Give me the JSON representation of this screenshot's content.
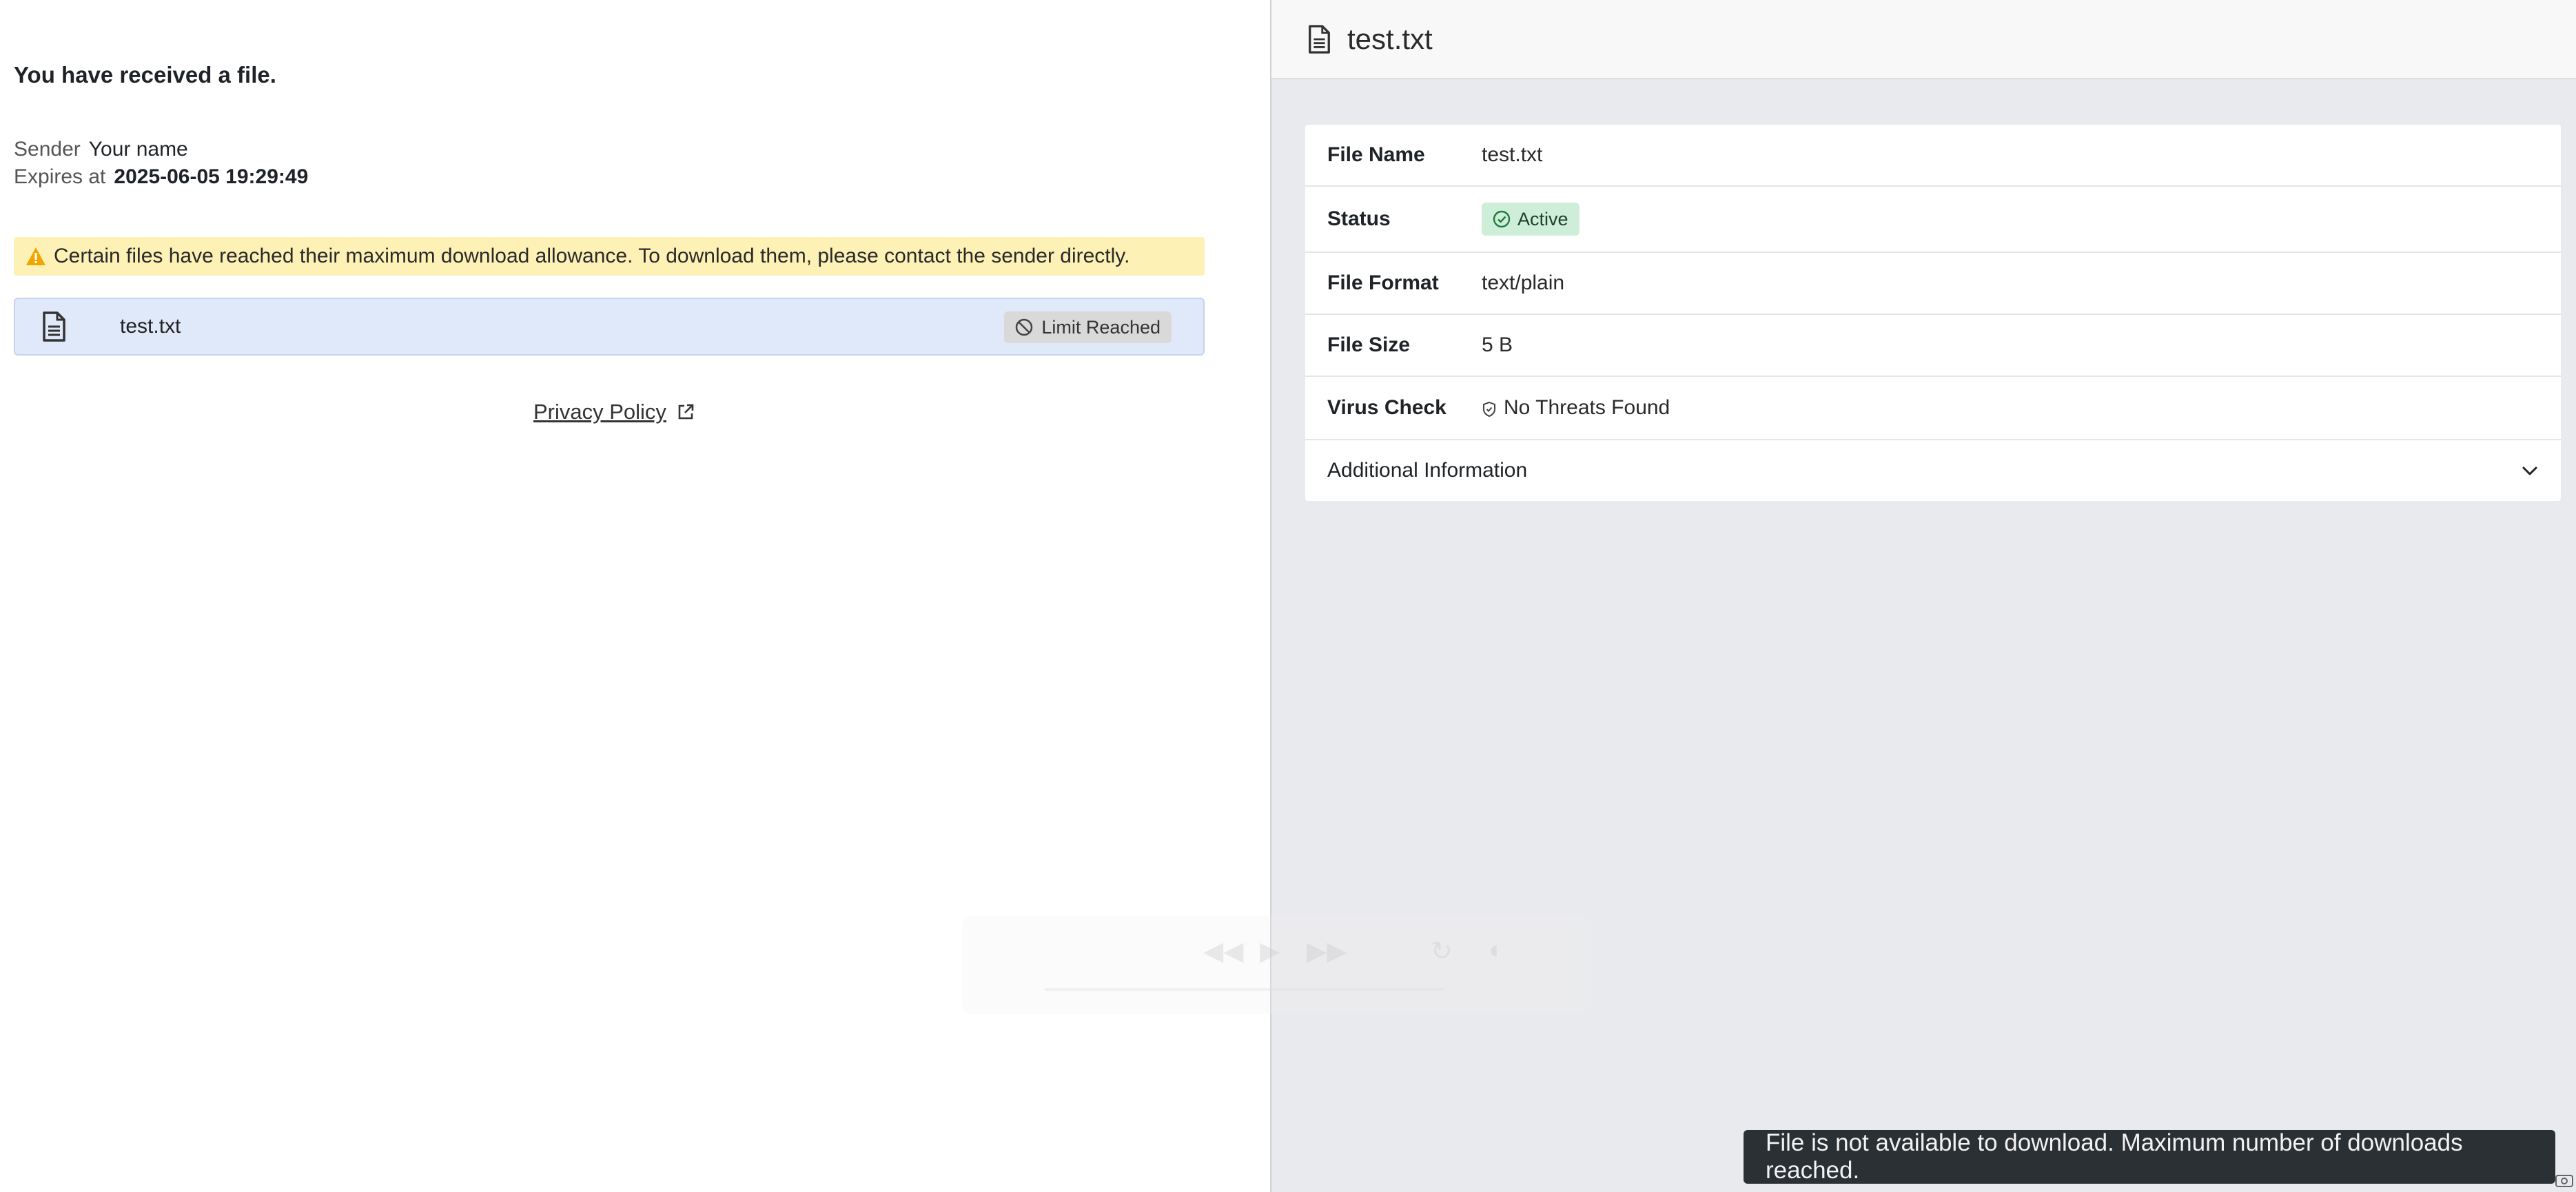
{
  "left": {
    "title": "You have received a file.",
    "sender_label": "Sender",
    "sender_value": "Your name",
    "expires_label": "Expires at",
    "expires_value": "2025-06-05 19:29:49",
    "warning_text": "Certain files have reached their maximum download allowance. To download them, please contact the sender directly.",
    "file": {
      "name": "test.txt",
      "badge": "Limit Reached"
    },
    "privacy_link": "Privacy Policy"
  },
  "right": {
    "header_title": "test.txt",
    "rows": {
      "file_name_label": "File Name",
      "file_name_value": "test.txt",
      "status_label": "Status",
      "status_value": "Active",
      "format_label": "File Format",
      "format_value": "text/plain",
      "size_label": "File Size",
      "size_value": "5 B",
      "virus_label": "Virus Check",
      "virus_value": "No Threats Found",
      "additional_label": "Additional Information"
    }
  },
  "toast": {
    "message": "File is not available to download. Maximum number of downloads reached."
  },
  "colors": {
    "warning_bg": "#fdf1b6",
    "file_row_bg": "#dfe9fa",
    "status_bg": "#cfeed9",
    "toast_bg": "#2b3034",
    "right_panel_bg": "#e9eaed"
  }
}
